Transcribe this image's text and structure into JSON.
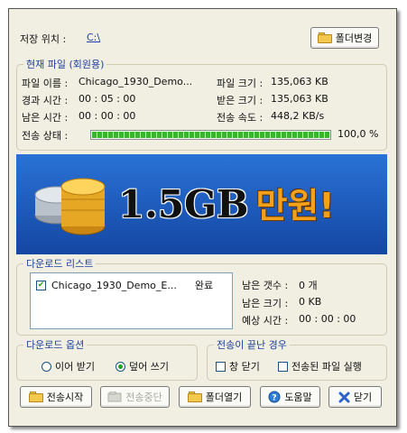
{
  "save_location": {
    "label": "저장 위치 :",
    "path": "C:\\",
    "change_folder_button": "폴더변경"
  },
  "current_file": {
    "group_title": "현재 파일 (회원용)",
    "filename_label": "파일 이름 :",
    "filename": "Chicago_1930_Demo...",
    "filesize_label": "파일 크기 :",
    "filesize": "135,063 KB",
    "elapsed_label": "경과 시간 :",
    "elapsed": "00 : 05 : 00",
    "received_label": "받은 크기 :",
    "received": "135,063 KB",
    "remaining_label": "남은 시간 :",
    "remaining": "00 : 00 : 00",
    "speed_label": "전송 속도 :",
    "speed": "448,2 KB/s",
    "status_label": "전송 상태 :",
    "progress_text": "100,0 %",
    "progress_fraction": 1.0
  },
  "banner": {
    "text_main": "1.5GB",
    "text_accent": "만원!",
    "bg_color": "#1a57b8",
    "accent_color": "#f3a11b",
    "icon": "gold-coins-icon"
  },
  "download_list": {
    "group_title": "다운로드 리스트",
    "items": [
      {
        "name": "Chicago_1930_Demo_E...",
        "status": "완료",
        "checked": true
      }
    ],
    "remaining_count_label": "남은 갯수 :",
    "remaining_count": "0 개",
    "remaining_size_label": "남은 크기 :",
    "remaining_size": "0 KB",
    "eta_label": "예상 시간 :",
    "eta": "00 : 00 : 00"
  },
  "download_options": {
    "group_title": "다운로드 옵션",
    "resume_label": "이어 받기",
    "overwrite_label": "덮어 쓰기",
    "selected": "overwrite"
  },
  "on_complete": {
    "group_title": "전송이 끝난 경우",
    "close_label": "창 닫기",
    "run_file_label": "전송된 파일 실행"
  },
  "buttons": {
    "start": "전송시작",
    "stop": "전송중단",
    "open_folder": "폴더열기",
    "help": "도움말",
    "close": "닫기"
  }
}
